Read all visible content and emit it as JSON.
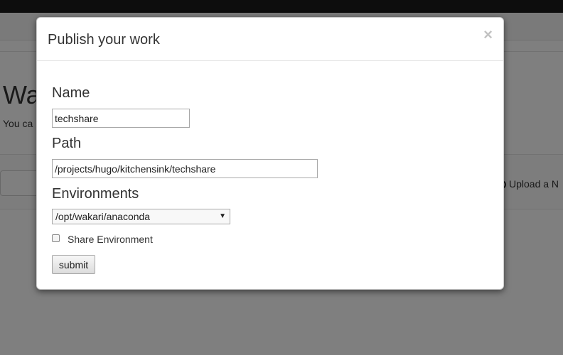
{
  "background": {
    "title_fragment": "Wa",
    "subtitle_fragment": "You ca",
    "upload_label": "Upload a N"
  },
  "modal": {
    "title": "Publish your work",
    "close_glyph": "×",
    "name_label": "Name",
    "name_value": "techshare",
    "path_label": "Path",
    "path_value": "/projects/hugo/kitchensink/techshare",
    "env_label": "Environments",
    "env_selected": "/opt/wakari/anaconda",
    "share_env_label": "Share Environment",
    "share_env_checked": false,
    "submit_label": "submit"
  },
  "icons": {
    "close": "close-icon",
    "dropdown": "chevron-down-icon",
    "upload": "upload-icon"
  }
}
